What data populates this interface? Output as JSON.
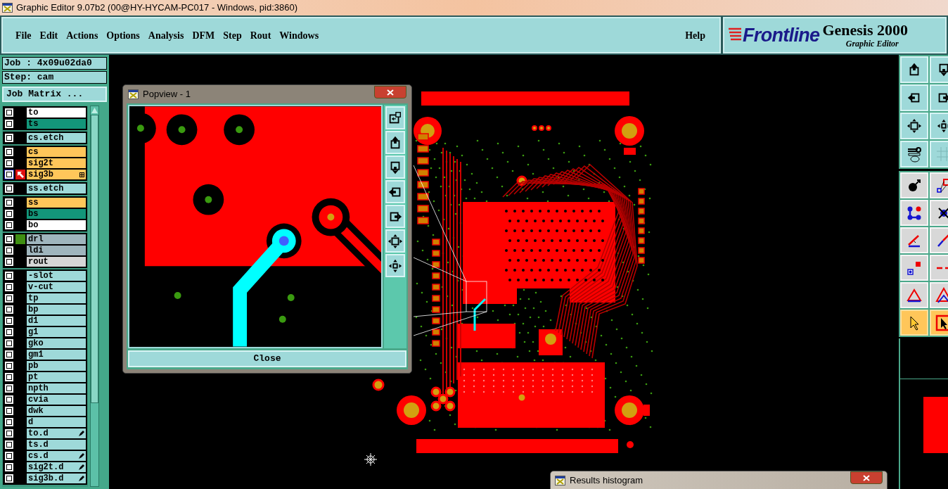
{
  "window": {
    "title": "Graphic Editor 9.07b2 (00@HY-HYCAM-PC017 - Windows, pid:3860)"
  },
  "menu": [
    "File",
    "Edit",
    "Actions",
    "Options",
    "Analysis",
    "DFM",
    "Step",
    "Rout",
    "Windows"
  ],
  "help": "Help",
  "logo": {
    "brand": "Frontline",
    "product": "Genesis 2000",
    "subtitle": "Graphic Editor"
  },
  "job": {
    "job": "Job : 4x09u02da0",
    "step": "Step: cam",
    "matrix_button": "Job Matrix ..."
  },
  "layer_groups": [
    {
      "layers": [
        {
          "name": "to",
          "color": "#ffffff",
          "work": false,
          "attached": false
        },
        {
          "name": "ts",
          "color": "#13967a",
          "work": false,
          "attached": false
        }
      ]
    },
    {
      "layers": [
        {
          "name": "cs.etch",
          "color": "#9ed9d9",
          "work": false,
          "attached": false
        }
      ]
    },
    {
      "layers": [
        {
          "name": "cs",
          "color": "#ffc65a",
          "work": false,
          "attached": false
        },
        {
          "name": "sig2t",
          "color": "#ffc65a",
          "work": false,
          "attached": false
        },
        {
          "name": "sig3b",
          "color": "#ffc65a",
          "work": true,
          "attached": false
        }
      ]
    },
    {
      "layers": [
        {
          "name": "ss.etch",
          "color": "#9ed9d9",
          "work": false,
          "attached": false
        }
      ]
    },
    {
      "layers": [
        {
          "name": "ss",
          "color": "#ffc65a",
          "work": false,
          "attached": false
        },
        {
          "name": "bs",
          "color": "#13967a",
          "work": false,
          "attached": false
        },
        {
          "name": "bo",
          "color": "#ffffff",
          "work": false,
          "attached": false
        }
      ]
    },
    {
      "layers": [
        {
          "name": "drl",
          "color": "#9fb5bd",
          "work": false,
          "attached": false,
          "swatch": {
            "color": "#3f8f12"
          }
        },
        {
          "name": "ldi",
          "color": "#9fb5bd",
          "work": false,
          "attached": false
        },
        {
          "name": "rout",
          "color": "#d6d6d6",
          "work": false,
          "attached": false
        }
      ]
    },
    {
      "layers": [
        {
          "name": "-slot",
          "color": "#9ed9d9",
          "work": false,
          "attached": false
        },
        {
          "name": "v-cut",
          "color": "#9ed9d9",
          "work": false,
          "attached": false
        },
        {
          "name": "tp",
          "color": "#9ed9d9",
          "work": false,
          "attached": false
        },
        {
          "name": "bp",
          "color": "#9ed9d9",
          "work": false,
          "attached": false
        },
        {
          "name": "d1",
          "color": "#9ed9d9",
          "work": false,
          "attached": false
        },
        {
          "name": "g1",
          "color": "#9ed9d9",
          "work": false,
          "attached": false
        },
        {
          "name": "gko",
          "color": "#9ed9d9",
          "work": false,
          "attached": false
        },
        {
          "name": "gm1",
          "color": "#9ed9d9",
          "work": false,
          "attached": false
        },
        {
          "name": "pb",
          "color": "#9ed9d9",
          "work": false,
          "attached": false
        },
        {
          "name": "pt",
          "color": "#9ed9d9",
          "work": false,
          "attached": false
        },
        {
          "name": "npth",
          "color": "#9ed9d9",
          "work": false,
          "attached": false
        },
        {
          "name": "cvia",
          "color": "#9ed9d9",
          "work": false,
          "attached": false
        },
        {
          "name": "dwk",
          "color": "#9ed9d9",
          "work": false,
          "attached": false
        },
        {
          "name": "d",
          "color": "#9ed9d9",
          "work": false,
          "attached": false
        },
        {
          "name": "to.d",
          "color": "#9ed9d9",
          "work": false,
          "attached": true
        },
        {
          "name": "ts.d",
          "color": "#9ed9d9",
          "work": false,
          "attached": false
        },
        {
          "name": "cs.d",
          "color": "#9ed9d9",
          "work": false,
          "attached": true
        },
        {
          "name": "sig2t.d",
          "color": "#9ed9d9",
          "work": false,
          "attached": true
        },
        {
          "name": "sig3b.d",
          "color": "#9ed9d9",
          "work": false,
          "attached": true
        }
      ]
    }
  ],
  "popview": {
    "title": "Popview - 1",
    "close": "Close",
    "buttons": [
      {
        "kind": "restore"
      },
      {
        "kind": "up"
      },
      {
        "kind": "down"
      },
      {
        "kind": "left"
      },
      {
        "kind": "right"
      },
      {
        "kind": "zoom-in"
      },
      {
        "kind": "zoom-out"
      }
    ]
  },
  "tools": [
    {
      "kind": "up",
      "selected": false
    },
    {
      "kind": "down",
      "selected": false
    },
    {
      "kind": "left",
      "selected": false
    },
    {
      "kind": "right",
      "selected": false
    },
    {
      "kind": "zoom-in",
      "selected": false
    },
    {
      "kind": "zoom-out",
      "selected": false
    },
    {
      "kind": "wrench",
      "selected": false
    },
    {
      "kind": "grid",
      "selected": false
    },
    {
      "kind": "feature",
      "selected": false
    },
    {
      "kind": "add",
      "selected": false
    },
    {
      "kind": "connect",
      "selected": false
    },
    {
      "kind": "cross",
      "selected": false
    },
    {
      "kind": "angle",
      "selected": false
    },
    {
      "kind": "line",
      "selected": false
    },
    {
      "kind": "pads",
      "selected": false
    },
    {
      "kind": "break",
      "selected": false
    },
    {
      "kind": "triangle",
      "selected": false
    },
    {
      "kind": "triangles",
      "selected": false
    },
    {
      "kind": "pointer",
      "selected": true
    },
    {
      "kind": "pointer-box",
      "selected": true
    }
  ],
  "histogram": {
    "title": "Results histogram"
  }
}
